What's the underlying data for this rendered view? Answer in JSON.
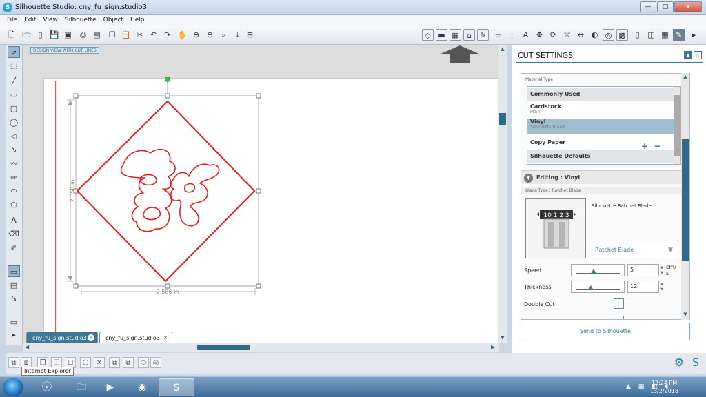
{
  "window": {
    "title": "Silhouette Studio: cny_fu_sign.studio3",
    "minimize": "—",
    "maximize": "□",
    "close": "x"
  },
  "menu": [
    "File",
    "Edit",
    "View",
    "Silhouette",
    "Object",
    "Help"
  ],
  "canvas": {
    "mode_badge": "DESIGN VIEW WITH CUT LINES",
    "dim_height": "2.658 in",
    "dim_width": "2.586 in",
    "line_color": "#e51b1b"
  },
  "tabs": [
    {
      "label": "cny_fu_sign.studio3",
      "close": "x",
      "active": true
    },
    {
      "label": "cny_fu_sign.studio3",
      "close": "x",
      "active": false
    }
  ],
  "tooltip": "Internet Explorer",
  "cut_settings": {
    "title": "CUT SETTINGS",
    "material_type_label": "Material Type",
    "materials": [
      {
        "name": "Commonly Used",
        "sub": "",
        "type": "header"
      },
      {
        "name": "Cardstock",
        "sub": "Plain",
        "type": "item"
      },
      {
        "name": "Vinyl",
        "sub": "Silhouette brand",
        "type": "selected"
      },
      {
        "name": "Copy Paper",
        "sub": "",
        "type": "item"
      },
      {
        "name": "Silhouette Defaults",
        "sub": "",
        "type": "header"
      }
    ],
    "add": "+",
    "remove": "−",
    "editing_label": "Editing : Vinyl",
    "blade_type_label": "Blade Type : Ratchet Blade",
    "blade_name": "Silhouette Ratchet Blade",
    "blade_dial": "10 1 2 3",
    "blade_select": "Ratchet Blade",
    "speed_label": "Speed",
    "speed_value": "5",
    "speed_unit": "cm/\ns",
    "speed_level": 0.4,
    "thickness_label": "Thickness",
    "thickness_value": "12",
    "thickness_level": 0.35,
    "double_cut_label": "Double Cut",
    "send_button": "Send to Silhouette"
  },
  "clock": {
    "time": "12:24 PM",
    "date": "13/2/2018"
  },
  "colors": {
    "accent": "#3e7894",
    "selection": "#9fbfd1"
  }
}
